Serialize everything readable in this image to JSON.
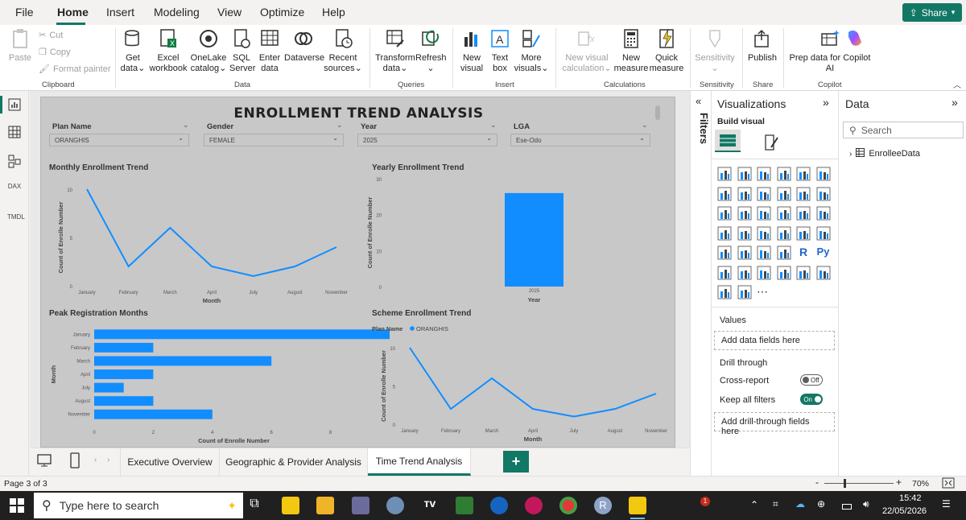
{
  "menu": {
    "file": "File",
    "home": "Home",
    "insert": "Insert",
    "modeling": "Modeling",
    "view": "View",
    "optimize": "Optimize",
    "help": "Help",
    "share": "Share"
  },
  "ribbon": {
    "clipboard": {
      "paste": "Paste",
      "cut": "Cut",
      "copy": "Copy",
      "format_painter": "Format painter",
      "group": "Clipboard"
    },
    "data": {
      "get_data_1": "Get",
      "get_data_2": "data",
      "excel_1": "Excel",
      "excel_2": "workbook",
      "onelake_1": "OneLake",
      "onelake_2": "catalog",
      "sql_1": "SQL",
      "sql_2": "Server",
      "enter_1": "Enter",
      "enter_2": "data",
      "dataverse": "Dataverse",
      "recent_1": "Recent",
      "recent_2": "sources",
      "group": "Data"
    },
    "queries": {
      "transform_1": "Transform",
      "transform_2": "data",
      "refresh": "Refresh",
      "group": "Queries"
    },
    "insert": {
      "new_visual_1": "New",
      "new_visual_2": "visual",
      "textbox_1": "Text",
      "textbox_2": "box",
      "more_1": "More",
      "more_2": "visuals",
      "group": "Insert"
    },
    "calculations": {
      "nvc_1": "New visual",
      "nvc_2": "calculation",
      "nm_1": "New",
      "nm_2": "measure",
      "qm_1": "Quick",
      "qm_2": "measure",
      "group": "Calculations"
    },
    "sensitivity": {
      "label": "Sensitivity",
      "group": "Sensitivity"
    },
    "share": {
      "publish": "Publish",
      "group": "Share"
    },
    "copilot": {
      "prep_1": "Prep data for Copilot",
      "prep_2": "AI",
      "group": "Copilot"
    }
  },
  "rail": {
    "dax": "DAX",
    "tmdl": "TMDL"
  },
  "report": {
    "title": "ENROLLMENT TREND ANALYSIS",
    "slicers": [
      {
        "title": "Plan Name",
        "value": "ORANGHIS"
      },
      {
        "title": "Gender",
        "value": "FEMALE"
      },
      {
        "title": "Year",
        "value": "2025"
      },
      {
        "title": "LGA",
        "value": "Ese-Odo"
      }
    ]
  },
  "chart_data": [
    {
      "type": "line",
      "title": "Monthly Enrollment Trend",
      "xlabel": "Month",
      "ylabel": "Count of Enrolle Number",
      "categories": [
        "January",
        "February",
        "March",
        "April",
        "July",
        "August",
        "November"
      ],
      "values": [
        10,
        2,
        6,
        2,
        1,
        2,
        4
      ],
      "ylim": [
        0,
        10
      ],
      "yticks": [
        0,
        5,
        10
      ],
      "color": "#118dff"
    },
    {
      "type": "bar",
      "title": "Yearly Enrollment Trend",
      "xlabel": "Year",
      "ylabel": "Count of Enrolle Number",
      "categories": [
        "2025"
      ],
      "values": [
        26
      ],
      "ylim": [
        0,
        30
      ],
      "yticks": [
        0,
        10,
        20,
        30
      ],
      "color": "#118dff"
    },
    {
      "type": "bar",
      "orientation": "horizontal",
      "title": "Peak Registration Months",
      "xlabel": "Count of Enrolle Number",
      "ylabel": "Month",
      "categories": [
        "January",
        "February",
        "March",
        "April",
        "July",
        "August",
        "November"
      ],
      "values": [
        10,
        2,
        6,
        2,
        1,
        2,
        4
      ],
      "xlim": [
        0,
        10
      ],
      "xticks": [
        0,
        2,
        4,
        6,
        8
      ],
      "color": "#118dff"
    },
    {
      "type": "line",
      "title": "Scheme Enrollment Trend",
      "xlabel": "Month",
      "ylabel": "Count of Enrolle Number",
      "legend_title": "Plan Name",
      "series": [
        {
          "name": "ORANGHIS",
          "values": [
            10,
            2,
            6,
            2,
            1,
            2,
            4
          ]
        }
      ],
      "categories": [
        "January",
        "February",
        "March",
        "April",
        "July",
        "August",
        "November"
      ],
      "ylim": [
        0,
        10
      ],
      "yticks": [
        0,
        5,
        10
      ],
      "color": "#118dff"
    }
  ],
  "tabs": {
    "t1": "Executive Overview",
    "t2": "Geographic & Provider Analysis",
    "t3": "Time Trend Analysis",
    "add": "+"
  },
  "filters": {
    "label": "Filters"
  },
  "viz": {
    "title": "Visualizations",
    "build": "Build visual",
    "values": "Values",
    "values_well": "Add data fields here",
    "drill": "Drill through",
    "cross": "Cross-report",
    "cross_state": "Off",
    "keep": "Keep all filters",
    "keep_state": "On",
    "drill_well": "Add drill-through fields here"
  },
  "data_pane": {
    "title": "Data",
    "search": "Search",
    "table": "EnrolleeData"
  },
  "status": {
    "page": "Page 3 of 3",
    "zoom": "70%"
  },
  "taskbar": {
    "search": "Type here to search",
    "time": "15:42",
    "date": "22/05/2026",
    "badge": "1"
  }
}
